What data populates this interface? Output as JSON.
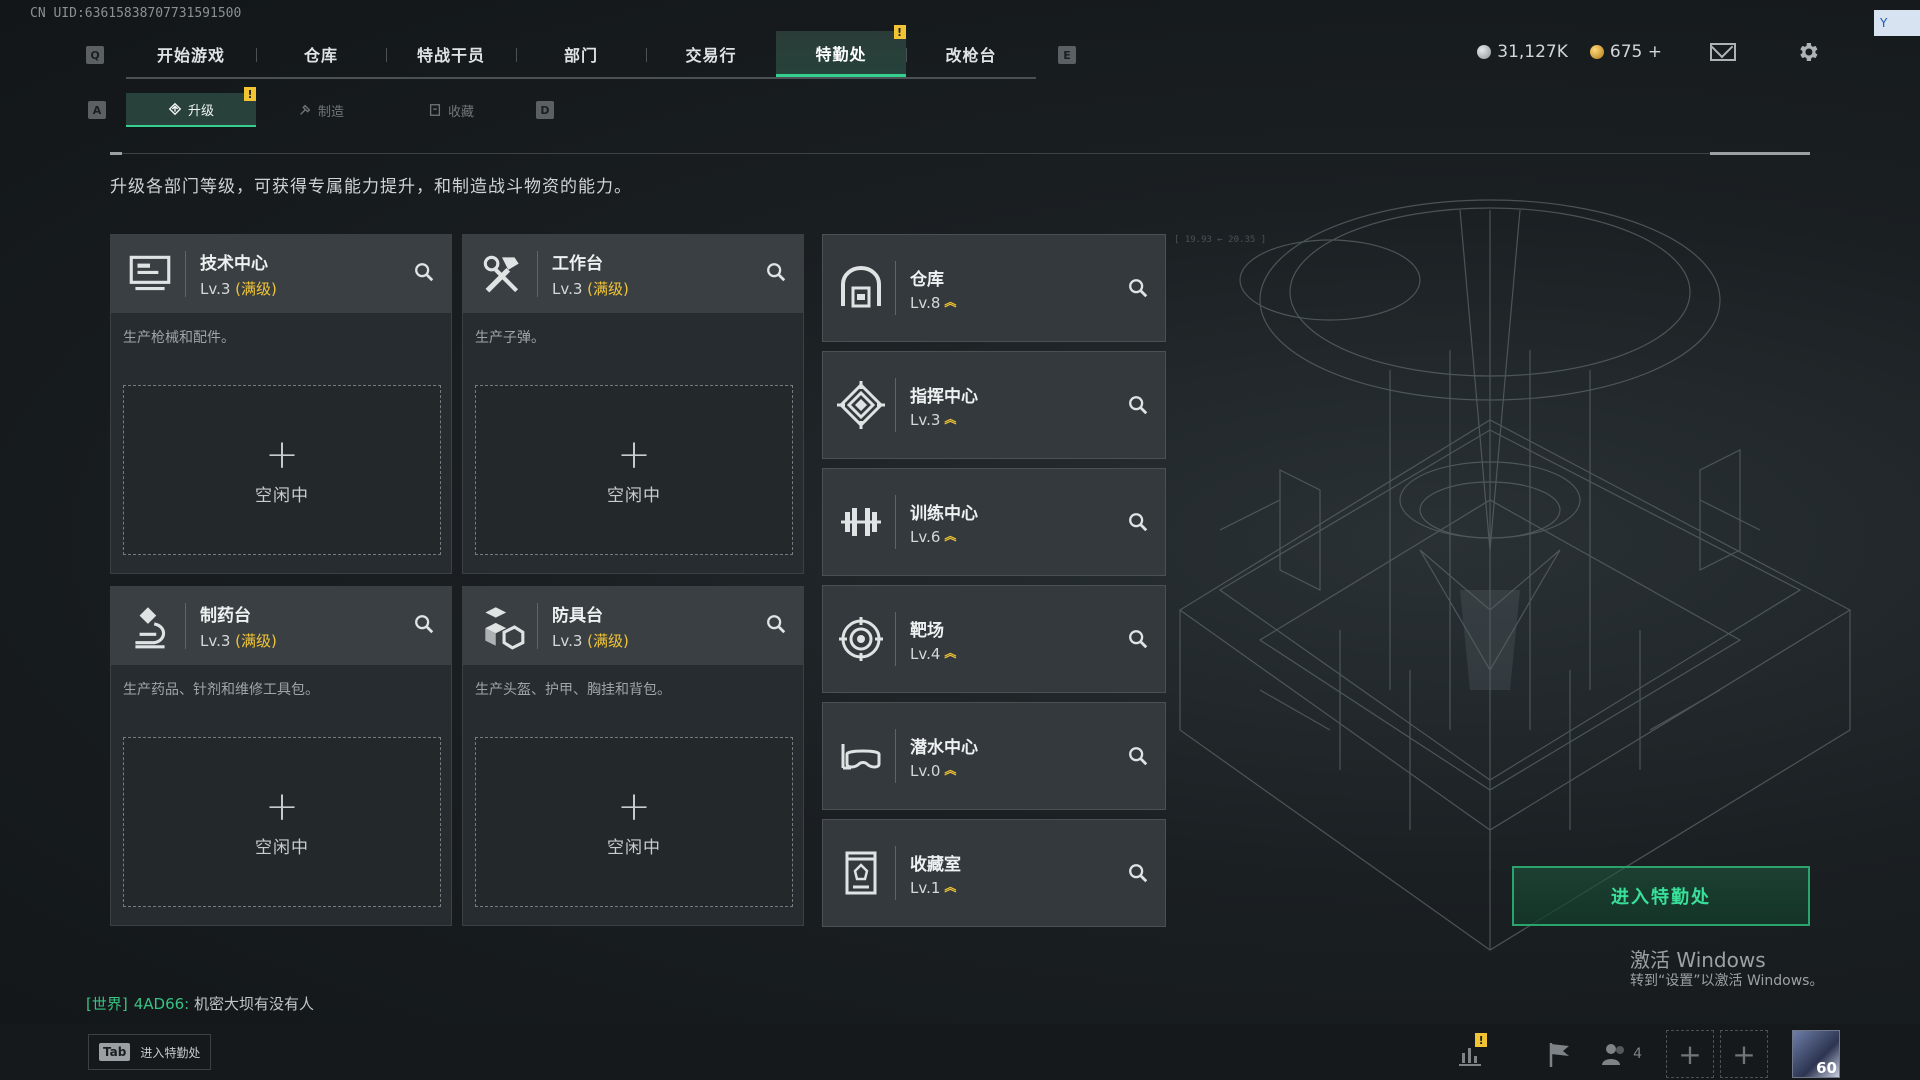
{
  "uid": "CN UID:636158387077315915​00",
  "nav": {
    "left_key": "Q",
    "right_key": "E",
    "tabs": [
      "开始游戏",
      "仓库",
      "特战干员",
      "部门",
      "交易行",
      "特勤处",
      "改枪台"
    ],
    "active_tab": "特勤处",
    "alert_badge": "!"
  },
  "currency": {
    "silver": "31,127K",
    "gold": "675 +"
  },
  "corner_tag": "Y",
  "subnav": {
    "left_key": "A",
    "right_key": "D",
    "tabs": [
      "升级",
      "制造",
      "收藏"
    ],
    "active": "升级",
    "alert_badge": "!"
  },
  "intro": "升级各部门等级，可获得专属能力提升，和制造战斗物资的能力。",
  "production": [
    {
      "name": "技术中心",
      "level": "Lv.3",
      "max_label": "(满级)",
      "desc": "生产枪械和配件。",
      "slot_plus": "+",
      "slot_status": "空闲中",
      "icon": "monitor-icon"
    },
    {
      "name": "工作台",
      "level": "Lv.3",
      "max_label": "(满级)",
      "desc": "生产子弹。",
      "slot_plus": "+",
      "slot_status": "空闲中",
      "icon": "tools-icon"
    },
    {
      "name": "制药台",
      "level": "Lv.3",
      "max_label": "(满级)",
      "desc": "生产药品、针剂和维修工具包。",
      "slot_plus": "+",
      "slot_status": "空闲中",
      "icon": "microscope-icon"
    },
    {
      "name": "防具台",
      "level": "Lv.3",
      "max_label": "(满级)",
      "desc": "生产头盔、护甲、胸挂和背包。",
      "slot_plus": "+",
      "slot_status": "空闲中",
      "icon": "boxes-icon"
    }
  ],
  "facilities": [
    {
      "name": "仓库",
      "level": "Lv.8",
      "icon": "warehouse-icon"
    },
    {
      "name": "指挥中心",
      "level": "Lv.3",
      "icon": "command-icon"
    },
    {
      "name": "训练中心",
      "level": "Lv.6",
      "icon": "dumbbell-icon"
    },
    {
      "name": "靶场",
      "level": "Lv.4",
      "icon": "target-icon"
    },
    {
      "name": "潜水中心",
      "level": "Lv.0",
      "icon": "dive-mask-icon"
    },
    {
      "name": "收藏室",
      "level": "Lv.1",
      "icon": "vault-icon"
    }
  ],
  "upgrade_chevron": "︽",
  "deco_text": "[ 19.93 ← 20.35 ]",
  "enter_button": "进入特勤处",
  "windows": {
    "title": "激活 Windows",
    "subtitle": "转到“设置”以激活 Windows。"
  },
  "chat": {
    "channel": "[世界]",
    "user": "4AD66:",
    "message": "机密大坝有没有人"
  },
  "tab_hint": {
    "key": "Tab",
    "label": "进入特勤处"
  },
  "bottom": {
    "alert_badge": "!",
    "friends_count": "4",
    "plus": "+",
    "player_level": "60"
  },
  "colors": {
    "accent": "#35d08f",
    "max_level": "#f2c434",
    "background": "#1a1f22"
  }
}
